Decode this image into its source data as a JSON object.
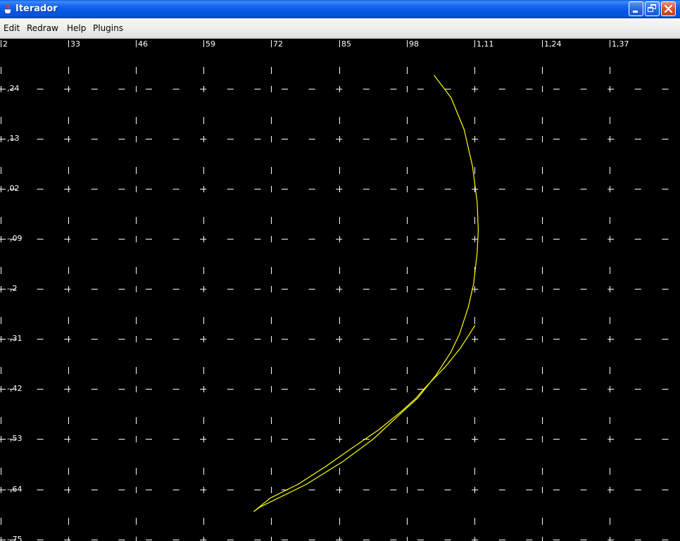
{
  "window": {
    "title": "Iterador",
    "icon": "java-cup-icon",
    "controls": [
      "minimize",
      "maximize",
      "close"
    ]
  },
  "menubar": {
    "items": [
      {
        "label": "Edit"
      },
      {
        "label": "Redraw"
      },
      {
        "label": "Help"
      },
      {
        "label": "Plugins"
      }
    ]
  },
  "colors": {
    "background": "#000000",
    "grid": "#ffffff",
    "curve": "#ffff00"
  },
  "chart_data": {
    "type": "line",
    "grid": true,
    "x_tick_labels": [
      "2",
      "33",
      "46",
      "59",
      "72",
      "85",
      "98",
      "1,11",
      "1,24",
      "1,37"
    ],
    "y_tick_labels": [
      ",24",
      ",13",
      ",02",
      "-,09",
      "-,2",
      "-,31",
      "-,42",
      "-,53",
      "-,64",
      "-,75"
    ],
    "series": [
      {
        "values": [
          [
            1.032,
            0.27
          ],
          [
            1.065,
            0.22
          ],
          [
            1.09,
            0.15
          ],
          [
            1.106,
            0.07
          ],
          [
            1.115,
            -0.01
          ],
          [
            1.117,
            -0.07
          ],
          [
            1.115,
            -0.12
          ],
          [
            1.108,
            -0.19
          ],
          [
            1.098,
            -0.24
          ],
          [
            1.081,
            -0.3
          ],
          [
            1.064,
            -0.34
          ],
          [
            1.036,
            -0.39
          ],
          [
            1.001,
            -0.44
          ],
          [
            0.972,
            -0.47
          ],
          [
            0.916,
            -0.53
          ],
          [
            0.857,
            -0.58
          ],
          [
            0.787,
            -0.63
          ],
          [
            0.698,
            -0.68
          ],
          [
            0.686,
            -0.69
          ]
        ]
      },
      {
        "values": [
          [
            1.111,
            -0.28
          ],
          [
            1.1,
            -0.3
          ],
          [
            1.083,
            -0.33
          ],
          [
            1.055,
            -0.37
          ],
          [
            1.013,
            -0.42
          ],
          [
            0.998,
            -0.44
          ],
          [
            0.969,
            -0.47
          ],
          [
            0.926,
            -0.51
          ],
          [
            0.875,
            -0.55
          ],
          [
            0.825,
            -0.59
          ],
          [
            0.771,
            -0.63
          ],
          [
            0.718,
            -0.66
          ],
          [
            0.686,
            -0.69
          ]
        ]
      }
    ]
  }
}
